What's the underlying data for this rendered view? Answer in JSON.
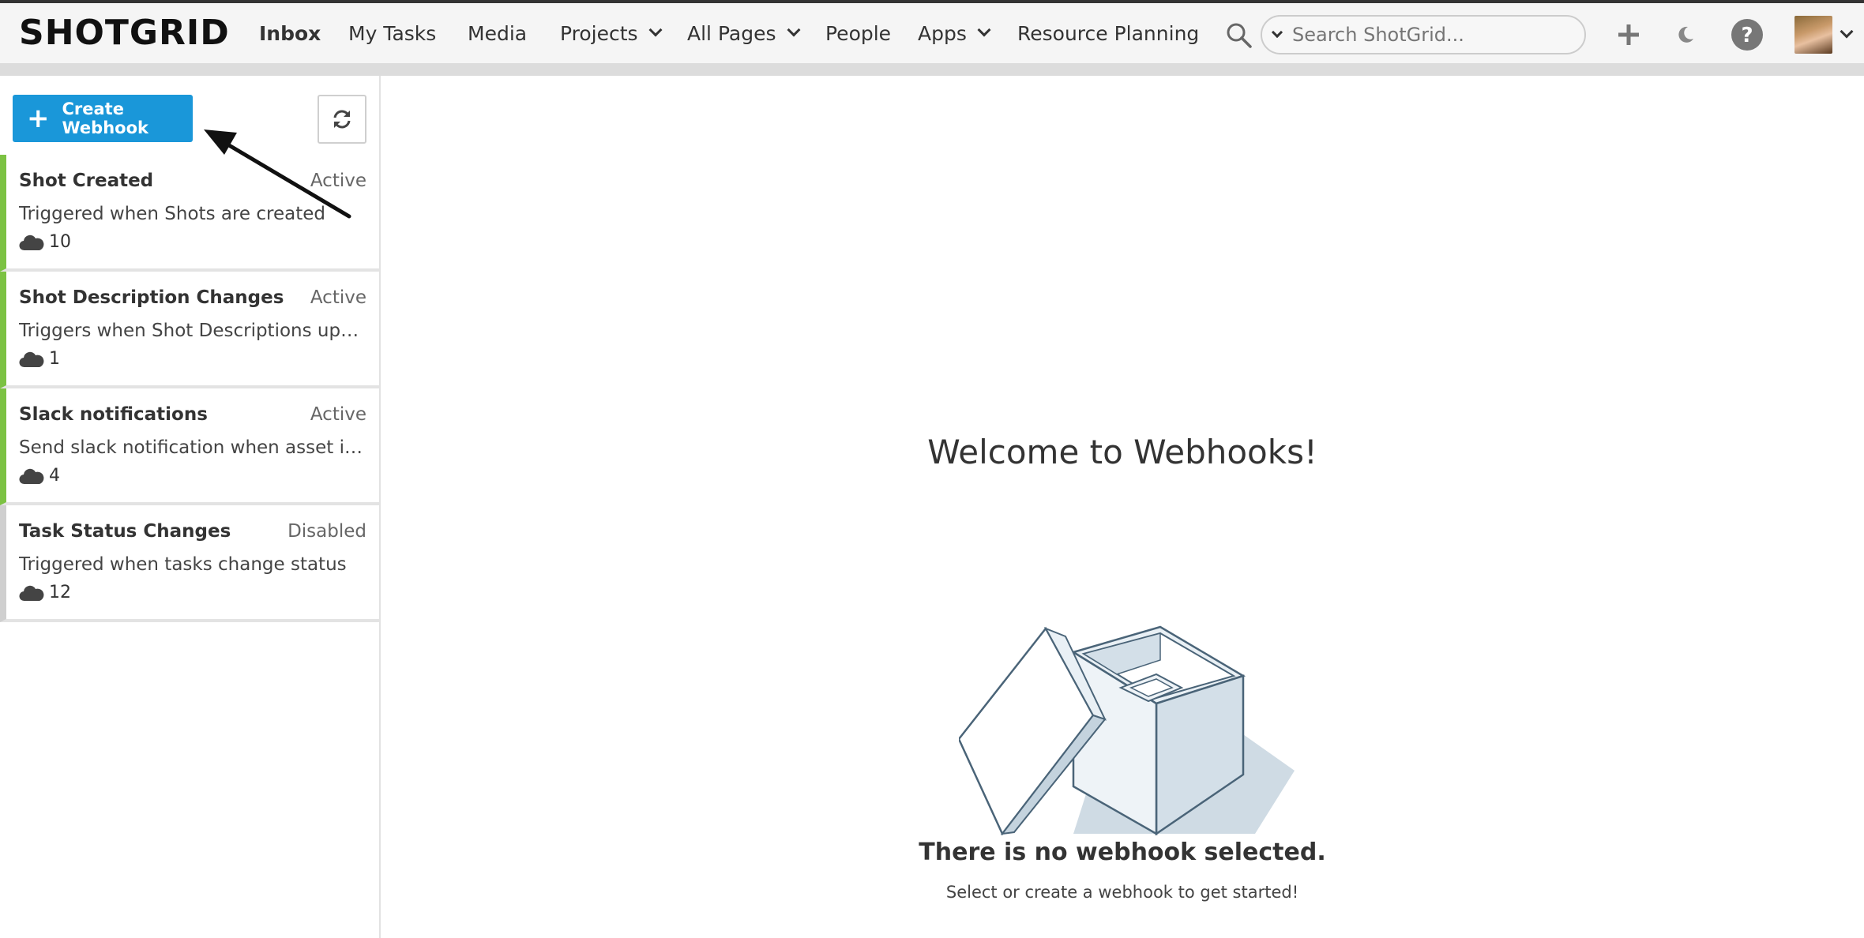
{
  "nav": {
    "logo": "SHOTGRID",
    "items": [
      {
        "label": "Inbox",
        "active": true,
        "dropdown": false
      },
      {
        "label": "My Tasks",
        "active": false,
        "dropdown": false
      },
      {
        "label": "Media",
        "active": false,
        "dropdown": false
      },
      {
        "label": "Projects",
        "active": false,
        "dropdown": true
      },
      {
        "label": "All Pages",
        "active": false,
        "dropdown": true
      },
      {
        "label": "People",
        "active": false,
        "dropdown": false
      },
      {
        "label": "Apps",
        "active": false,
        "dropdown": true
      },
      {
        "label": "Resource Planning",
        "active": false,
        "dropdown": false
      }
    ],
    "search_placeholder": "Search ShotGrid...",
    "icons": [
      "search-icon",
      "plus-icon",
      "moon-icon",
      "help-icon",
      "avatar"
    ]
  },
  "sidebar": {
    "create_button_label": "Create Webhook",
    "refresh_icon": "refresh-icon",
    "webhooks": [
      {
        "name": "Shot Created",
        "status": "Active",
        "description": "Triggered when Shots are created",
        "count": "10"
      },
      {
        "name": "Shot Description Changes",
        "status": "Active",
        "description": "Triggers when Shot Descriptions updated",
        "count": "1"
      },
      {
        "name": "Slack notifications",
        "status": "Active",
        "description": "Send slack notification when asset is created",
        "count": "4"
      },
      {
        "name": "Task Status Changes",
        "status": "Disabled",
        "description": "Triggered when tasks change status",
        "count": "12"
      }
    ]
  },
  "main": {
    "welcome_title": "Welcome to Webhooks!",
    "empty_title": "There is no webhook selected.",
    "empty_subtitle": "Select or create a webhook to get started!"
  },
  "colors": {
    "accent_blue": "#1a97d9",
    "active_green": "#7cc243",
    "disabled_gray": "#cfcfcf"
  }
}
